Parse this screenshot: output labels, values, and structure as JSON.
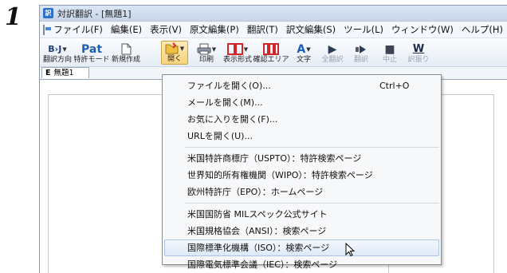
{
  "step_number": "1",
  "window": {
    "title": "対訳翻訳 - [無題1]",
    "icon": "app-icon"
  },
  "menubar": {
    "items": [
      "ファイル(F)",
      "編集(E)",
      "表示(V)",
      "原文編集(P)",
      "翻訳(T)",
      "訳文編集(S)",
      "ツール(L)",
      "ウィンドウ(W)",
      "ヘルプ(H)"
    ]
  },
  "toolbar": {
    "buttons": [
      {
        "label": "翻訳方向",
        "icon": "translation-direction-icon",
        "glyph": "B›J"
      },
      {
        "label": "特許モード",
        "icon": "patent-mode-icon",
        "glyph": "Pat"
      },
      {
        "label": "新規作成",
        "icon": "new-document-icon",
        "glyph": ""
      },
      {
        "label": "開く",
        "icon": "open-folder-icon",
        "glyph": ""
      },
      {
        "label": "印刷",
        "icon": "printer-icon",
        "glyph": ""
      },
      {
        "label": "表示形式",
        "icon": "display-format-icon",
        "glyph": ""
      },
      {
        "label": "確認エリア",
        "icon": "confirm-area-icon",
        "glyph": ""
      },
      {
        "label": "文字",
        "icon": "text-font-icon",
        "glyph": "A"
      },
      {
        "label": "全翻訳",
        "icon": "translate-all-icon",
        "glyph": "▶"
      },
      {
        "label": "翻訳",
        "icon": "translate-icon",
        "glyph": ""
      },
      {
        "label": "中止",
        "icon": "stop-icon",
        "glyph": "■"
      },
      {
        "label": "訳振り",
        "icon": "ruby-translation-icon",
        "glyph": "W"
      }
    ]
  },
  "document_tab": {
    "prefix": "E",
    "label": "無題1"
  },
  "open_menu": {
    "items": [
      {
        "label": "ファイルを開く(O)...",
        "shortcut": "Ctrl+O"
      },
      {
        "label": "メールを開く(M)..."
      },
      {
        "label": "お気に入りを開く(F)..."
      },
      {
        "label": "URLを開く(U)..."
      },
      {
        "label": "米国特許商標庁（USPTO）：特許検索ページ"
      },
      {
        "label": "世界知的所有権機関（WIPO）：特許検索ページ"
      },
      {
        "label": "欧州特許庁（EPO）：ホームページ"
      },
      {
        "label": "米国国防省 MILスペック公式サイト"
      },
      {
        "label": "米国規格協会（ANSI）：検索ページ"
      },
      {
        "label": "国際標準化機構（ISO）：検索ページ"
      },
      {
        "label": "国際電気標準会議（IEC）：検索ページ"
      }
    ],
    "highlighted_index": 9
  },
  "colors": {
    "accent_blue": "#2a6fc8",
    "highlight": "#dde9f7",
    "active_button": "#f7d37a"
  }
}
